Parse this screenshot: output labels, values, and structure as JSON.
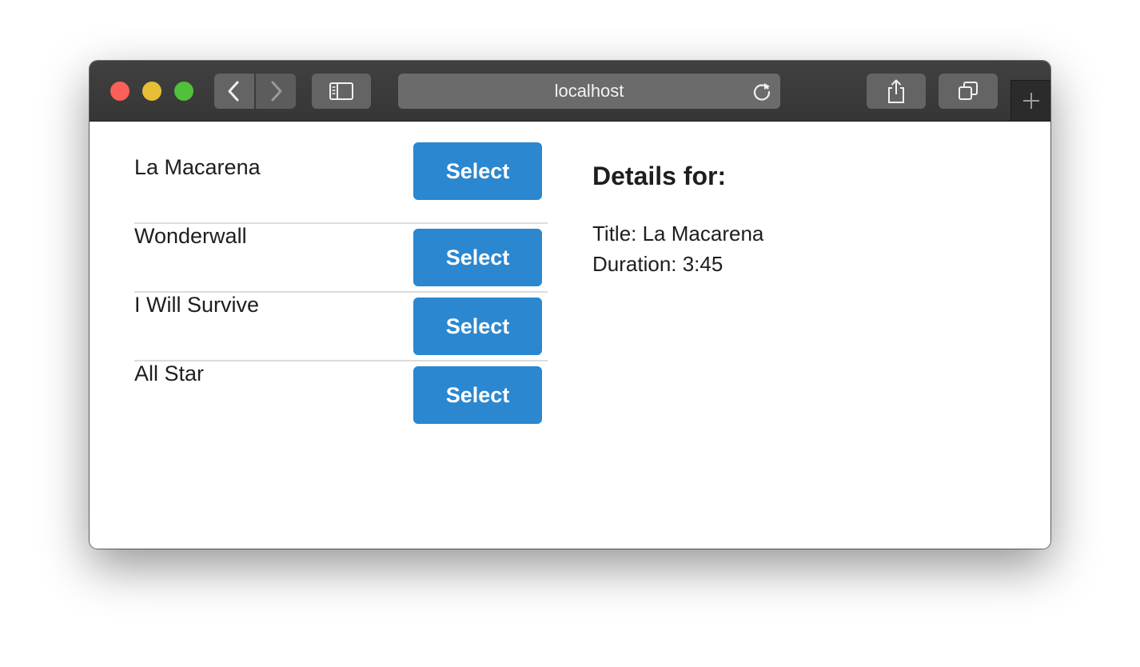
{
  "browser": {
    "url": "localhost",
    "icons": {
      "back": "chevron-left-icon",
      "forward": "chevron-right-icon",
      "sidebar": "sidebar-icon",
      "reload": "reload-icon",
      "share": "share-icon",
      "tabs": "tabs-overview-icon",
      "new_tab": "plus-icon"
    },
    "traffic_lights": [
      "#fc5f57",
      "#e8bd36",
      "#4fc13a"
    ]
  },
  "songs": [
    {
      "title": "La Macarena",
      "button_label": "Select"
    },
    {
      "title": "Wonderwall",
      "button_label": "Select"
    },
    {
      "title": "I Will Survive",
      "button_label": "Select"
    },
    {
      "title": "All Star",
      "button_label": "Select"
    }
  ],
  "details": {
    "heading": "Details for:",
    "title_line": "Title: La Macarena",
    "duration_line": "Duration: 3:45"
  },
  "colors": {
    "button": "#2b87cf",
    "toolbar": "#3c3c3c"
  }
}
